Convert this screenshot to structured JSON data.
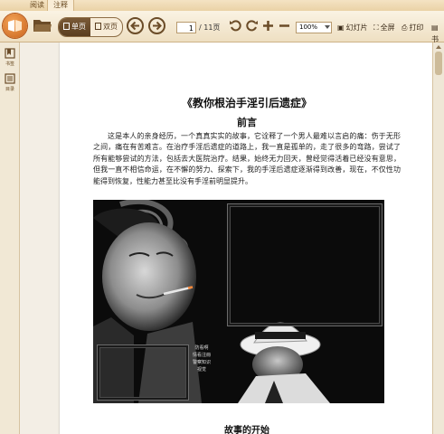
{
  "tabs": [
    {
      "label": "阅读"
    },
    {
      "label": "注释"
    }
  ],
  "toolbar": {
    "single_page": "单页",
    "double_page": "双页",
    "page_current": "1",
    "page_total": "/ 11页",
    "zoom": "100%",
    "slideshow": "幻灯片",
    "fullscreen": "全屏",
    "print": "打印",
    "more": "书"
  },
  "sidebar": {
    "items": [
      {
        "label": "书签"
      },
      {
        "label": "目录"
      }
    ]
  },
  "document": {
    "title": "《教你根治手淫引后遗症》",
    "heading": "前言",
    "paragraph": "这是本人的亲身经历，一个真真实实的故事，它诠释了一个男人最难以言启的痛：伤于无形之间，痛在有苦难言。在治疗手淫后遗症的道路上，我一直是孤单的，走了很多的弯路，尝试了所有能够尝试的方法，包括去大医院治疗。结果，始终无力回天，曾经觉得活着已经没有意思，但我一直不相信命运，在不懈的努力、探索下，我的手淫后遗症逐渐得到改善，现在，不仅性功能得到恢复，性能力甚至比没有手淫前明显提升。",
    "image_lines": [
      "防看啊",
      "情看注冊",
      "警察知识",
      "视觉"
    ],
    "subheading": "故事的开始"
  }
}
